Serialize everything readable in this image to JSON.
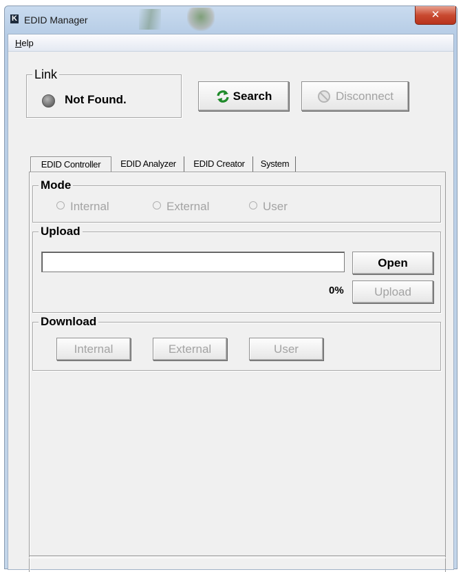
{
  "window": {
    "title": "EDID Manager",
    "logo_letter": "K",
    "close_glyph": "✕"
  },
  "menubar": {
    "help_label": "Help",
    "help_hotkey": "H",
    "help_rest": "elp"
  },
  "link": {
    "group_title": "Link",
    "status": "Not Found.",
    "indicator_color": "#7a7a7a"
  },
  "toolbar": {
    "search_label": "Search",
    "search_icon": "refresh-icon",
    "disconnect_label": "Disconnect",
    "disconnect_icon": "disconnect-icon"
  },
  "tabs": [
    {
      "label": "EDID Controller",
      "active": true
    },
    {
      "label": "EDID Analyzer",
      "active": false
    },
    {
      "label": "EDID Creator",
      "active": false
    },
    {
      "label": "System",
      "active": false
    }
  ],
  "mode": {
    "title": "Mode",
    "options": [
      "Internal",
      "External",
      "User"
    ]
  },
  "upload": {
    "title": "Upload",
    "file_value": "",
    "open_label": "Open",
    "progress_text": "0%",
    "upload_label": "Upload"
  },
  "download": {
    "title": "Download",
    "buttons": [
      "Internal",
      "External",
      "User"
    ]
  }
}
